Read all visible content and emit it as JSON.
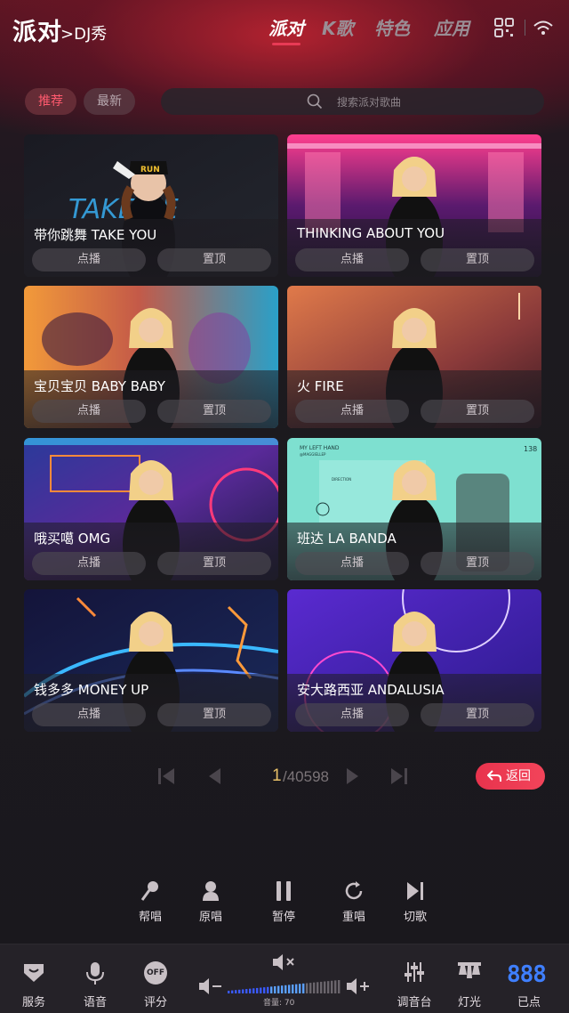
{
  "header": {
    "title": "派对",
    "subtitle": ">DJ秀",
    "tabs": [
      {
        "label": "派对",
        "active": true
      },
      {
        "label": "K歌",
        "active": false
      },
      {
        "label": "特色",
        "active": false
      },
      {
        "label": "应用",
        "active": false
      }
    ],
    "icons": [
      "qrcode-icon",
      "wifi-icon"
    ]
  },
  "filters": {
    "chips": [
      {
        "label": "推荐",
        "active": true
      },
      {
        "label": "最新",
        "active": false
      }
    ],
    "search_placeholder": "搜索派对歌曲"
  },
  "songs": [
    {
      "name": "带你跳舞  TAKE YOU",
      "play_label": "点播",
      "top_label": "置顶"
    },
    {
      "name": "THINKING ABOUT YOU",
      "play_label": "点播",
      "top_label": "置顶"
    },
    {
      "name": "宝贝宝贝 BABY BABY",
      "play_label": "点播",
      "top_label": "置顶"
    },
    {
      "name": "火 FIRE",
      "play_label": "点播",
      "top_label": "置顶"
    },
    {
      "name": "哦买噶 OMG",
      "play_label": "点播",
      "top_label": "置顶"
    },
    {
      "name": "班达 LA BANDA",
      "play_label": "点播",
      "top_label": "置顶"
    },
    {
      "name": "钱多多 MONEY UP",
      "play_label": "点播",
      "top_label": "置顶"
    },
    {
      "name": "安大路西亚 ANDALUSIA",
      "play_label": "点播",
      "top_label": "置顶"
    }
  ],
  "card_art_text": {
    "card1_cap": "RUN",
    "card1_neon": "TAKE  ZE",
    "card6_top_left": "MY LEFT HAND",
    "card6_top_left2": "@MAGGIELLEP",
    "card6_mid": "DIRECTION",
    "card6_top_right": "138"
  },
  "pagination": {
    "current": "1",
    "total": "/40598",
    "back_label": "返回"
  },
  "controls": [
    {
      "label": "帮唱",
      "icon": "microphone-icon"
    },
    {
      "label": "原唱",
      "icon": "singer-icon"
    },
    {
      "label": "暂停",
      "icon": "pause-icon"
    },
    {
      "label": "重唱",
      "icon": "replay-icon"
    },
    {
      "label": "切歌",
      "icon": "skip-icon"
    }
  ],
  "bottom_bar": {
    "service": "服务",
    "voice": "语音",
    "score": "评分",
    "score_badge": "OFF",
    "volume_label": "音量: 70",
    "volume_value": 70,
    "mixer": "调音台",
    "lights": "灯光",
    "ordered": "已点",
    "ordered_count": "888"
  },
  "colors": {
    "accent": "#e8334d",
    "page_number": "#e8c068",
    "ordered_count": "#3f7fff"
  }
}
